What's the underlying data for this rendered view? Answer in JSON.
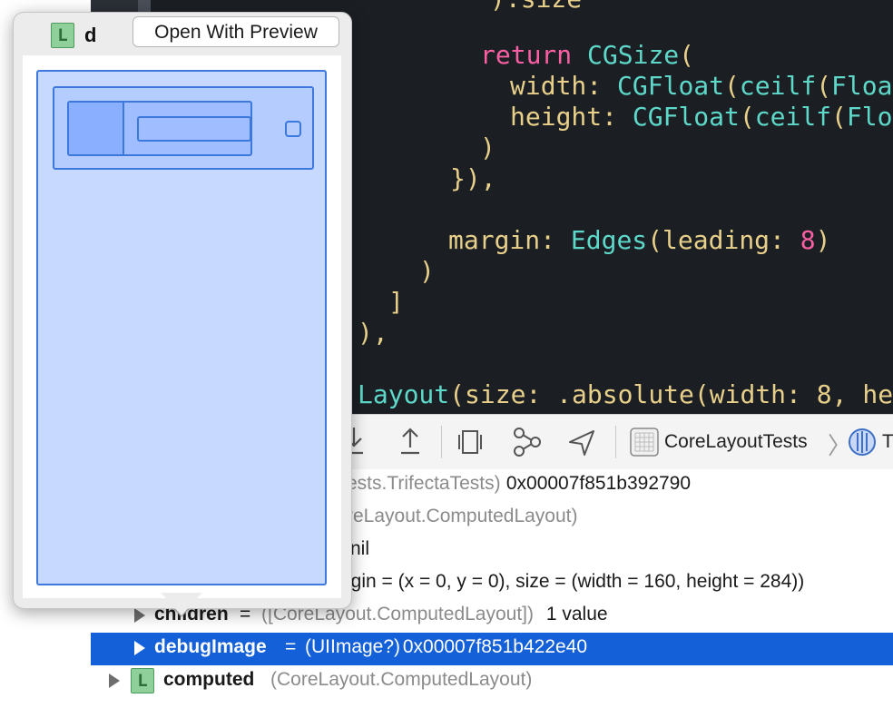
{
  "editor": {
    "lines": [
      {
        "indent": "",
        "parts": [
          {
            "t": ").size",
            "c": "pu"
          }
        ]
      },
      {
        "indent": "",
        "parts": [
          {
            "t": "return",
            "c": "kw"
          },
          {
            "t": " ",
            "c": "pu"
          },
          {
            "t": "CGSize",
            "c": "ty"
          },
          {
            "t": "(",
            "c": "pu"
          }
        ]
      },
      {
        "indent": "",
        "parts": [
          {
            "t": "width",
            "c": "pa"
          },
          {
            "t": ": ",
            "c": "pu"
          },
          {
            "t": "CGFloat",
            "c": "ty"
          },
          {
            "t": "(",
            "c": "pu"
          },
          {
            "t": "ceilf",
            "c": "ty"
          },
          {
            "t": "(",
            "c": "pu"
          },
          {
            "t": "Float",
            "c": "ty"
          }
        ]
      },
      {
        "indent": "",
        "parts": [
          {
            "t": "height",
            "c": "pa"
          },
          {
            "t": ": ",
            "c": "pu"
          },
          {
            "t": "CGFloat",
            "c": "ty"
          },
          {
            "t": "(",
            "c": "pu"
          },
          {
            "t": "ceilf",
            "c": "ty"
          },
          {
            "t": "(",
            "c": "pu"
          },
          {
            "t": "Float",
            "c": "ty"
          }
        ]
      },
      {
        "indent": "",
        "parts": [
          {
            "t": ")",
            "c": "pu"
          }
        ]
      },
      {
        "indent": "",
        "parts": [
          {
            "t": "}),",
            "c": "pu"
          }
        ]
      },
      {
        "indent": "",
        "parts": [
          {
            "t": "margin",
            "c": "pa"
          },
          {
            "t": ": ",
            "c": "pu"
          },
          {
            "t": "Edges",
            "c": "ty"
          },
          {
            "t": "(",
            "c": "pu"
          },
          {
            "t": "leading",
            "c": "pa"
          },
          {
            "t": ": ",
            "c": "pu"
          },
          {
            "t": "8",
            "c": "kw"
          },
          {
            "t": ")",
            "c": "pu"
          }
        ]
      },
      {
        "indent": "",
        "parts": [
          {
            "t": ")",
            "c": "pu"
          }
        ]
      },
      {
        "indent": "",
        "parts": [
          {
            "t": "]",
            "c": "pu"
          }
        ]
      },
      {
        "indent": "",
        "parts": [
          {
            "t": "),",
            "c": "pu"
          }
        ]
      },
      {
        "indent": "",
        "parts": [
          {
            "t": "Layout",
            "c": "ty"
          },
          {
            "t": "(",
            "c": "pu"
          },
          {
            "t": "size",
            "c": "pa"
          },
          {
            "t": ": .",
            "c": "pu"
          },
          {
            "t": "absolute",
            "c": "pa"
          },
          {
            "t": "(",
            "c": "pu"
          },
          {
            "t": "width",
            "c": "pa"
          },
          {
            "t": ": ",
            "c": "pu"
          },
          {
            "t": "8",
            "c": "pa"
          },
          {
            "t": ", ",
            "c": "pu"
          },
          {
            "t": "he",
            "c": "pa"
          }
        ]
      }
    ]
  },
  "toolbar": {
    "buttons": [
      "step-into-icon",
      "step-out-icon",
      "view-hierarchy-icon",
      "memory-graph-icon",
      "location-icon"
    ],
    "breadcrumb": {
      "project": "CoreLayoutTests",
      "next": "Tr"
    }
  },
  "variables": {
    "rows": [
      {
        "name": "",
        "type": "ests.TrifectaTests)",
        "value": " 0x00007f851b392790"
      },
      {
        "name": "",
        "type": "reLayout.ComputedLayout)",
        "value": ""
      },
      {
        "name": "",
        "type": "",
        "value": "nil"
      },
      {
        "name": "",
        "type": "",
        "value": "igin = (x = 0, y = 0), size = (width = 160, height = 284))"
      },
      {
        "name": "children",
        "type": "([CoreLayout.ComputedLayout])",
        "value": " 1 value"
      },
      {
        "name": "debugImage",
        "type": "(UIImage?)",
        "value": " 0x00007f851b422e40"
      },
      {
        "name": "computed",
        "type": "(CoreLayout.ComputedLayout)",
        "value": "",
        "badge": "L"
      }
    ]
  },
  "popover": {
    "badge": "L",
    "title": "d",
    "open_button": "Open With Preview"
  },
  "colors": {
    "selection": "#1460d8",
    "editor_bg": "#1b1f24",
    "preview_fill": "#c7d9ff",
    "preview_stroke": "#3d78dc"
  }
}
